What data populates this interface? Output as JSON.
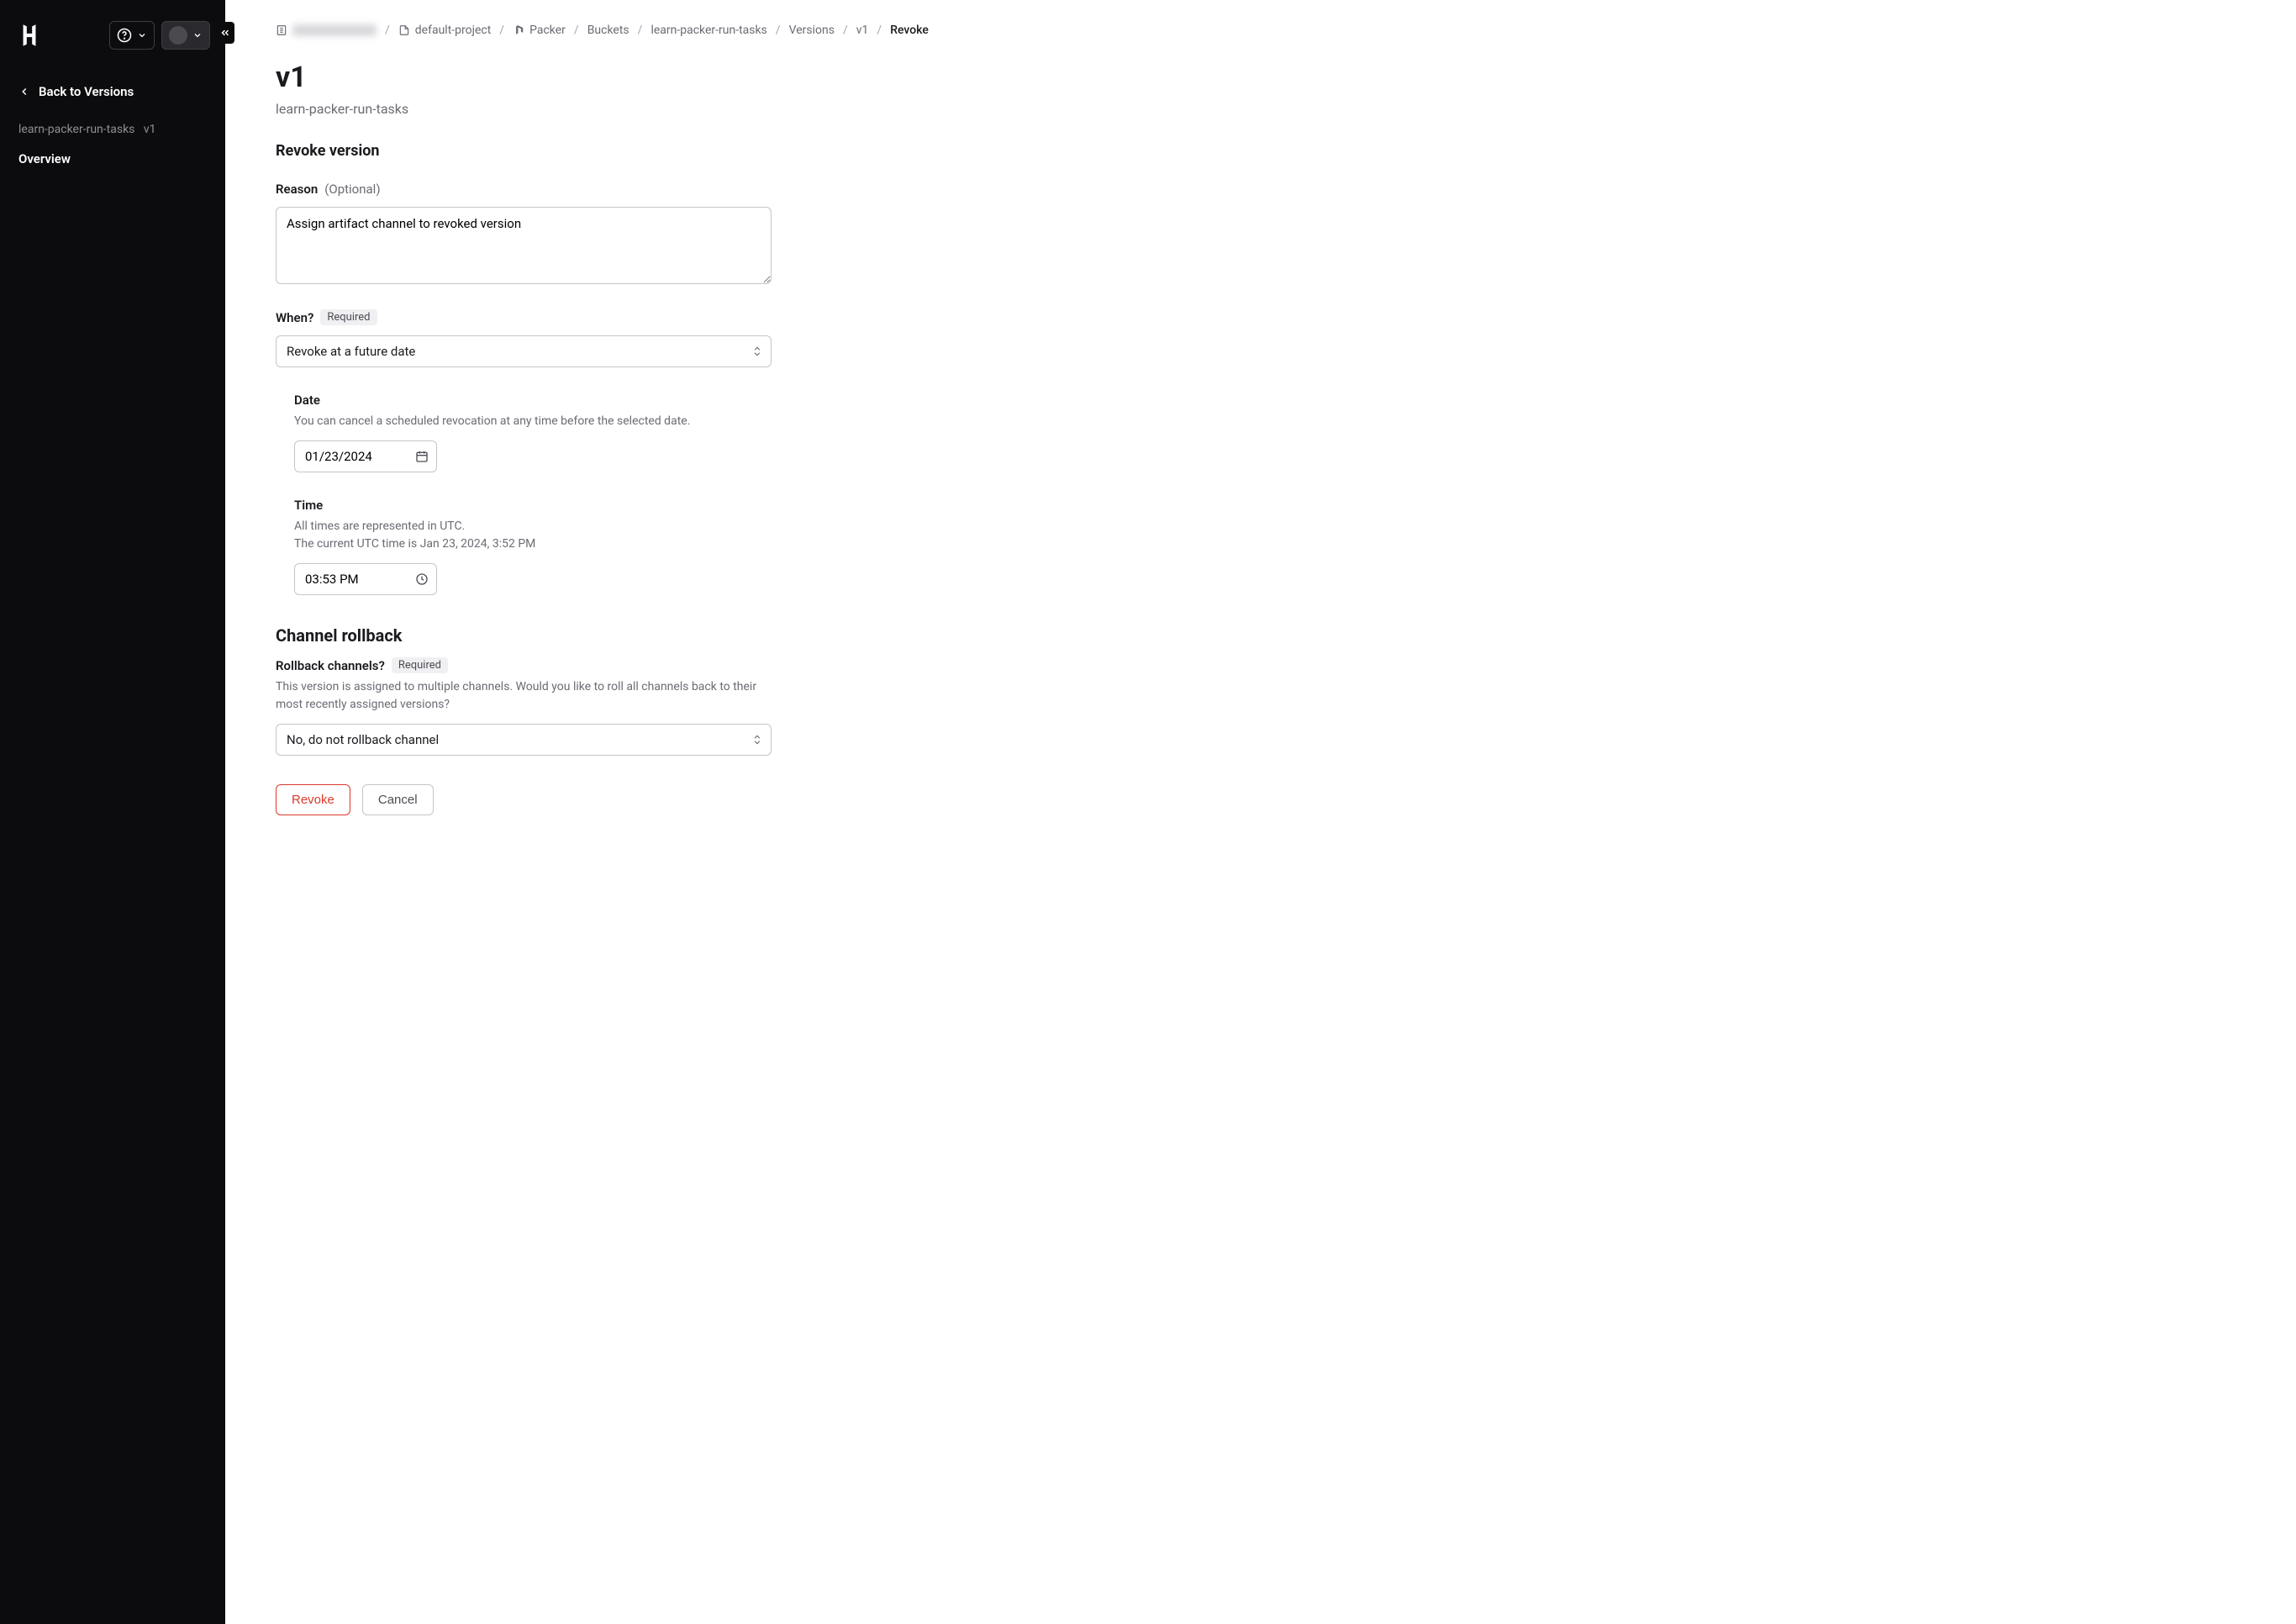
{
  "sidebar": {
    "back_label": "Back to Versions",
    "context_bucket": "learn-packer-run-tasks",
    "context_version": "v1",
    "nav_overview": "Overview"
  },
  "breadcrumb": {
    "project": "default-project",
    "packer": "Packer",
    "buckets": "Buckets",
    "bucket_name": "learn-packer-run-tasks",
    "versions": "Versions",
    "version": "v1",
    "revoke": "Revoke"
  },
  "page": {
    "title": "v1",
    "subtitle": "learn-packer-run-tasks"
  },
  "revoke": {
    "section_title": "Revoke version",
    "reason_label": "Reason",
    "reason_optional": "(Optional)",
    "reason_value": "Assign artifact channel to revoked version",
    "when_label": "When?",
    "required_badge": "Required",
    "when_value": "Revoke at a future date",
    "date_label": "Date",
    "date_help": "You can cancel a scheduled revocation at any time before the selected date.",
    "date_value": "01/23/2024",
    "time_label": "Time",
    "time_help_1": "All times are represented in UTC.",
    "time_help_2": "The current UTC time is Jan 23, 2024, 3:52 PM",
    "time_value": "03:53 PM"
  },
  "rollback": {
    "section_title": "Channel rollback",
    "label": "Rollback channels?",
    "required_badge": "Required",
    "help": "This version is assigned to multiple channels. Would you like to roll all channels back to their most recently assigned versions?",
    "value": "No, do not rollback channel"
  },
  "buttons": {
    "revoke": "Revoke",
    "cancel": "Cancel"
  }
}
